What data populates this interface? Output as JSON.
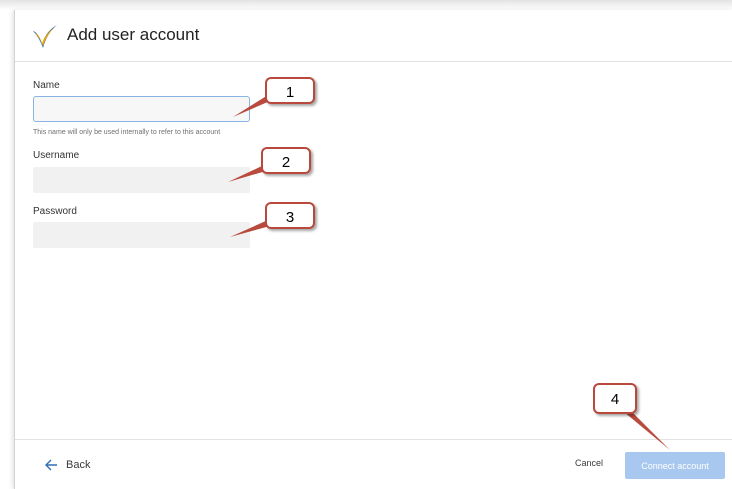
{
  "dialog": {
    "title": "Add user account",
    "logo_icon": "sap-checkmark-logo"
  },
  "form": {
    "name_label": "Name",
    "name_value": "",
    "name_hint": "This name will only be used internally to refer to this account",
    "username_label": "Username",
    "username_value": "",
    "password_label": "Password",
    "password_value": ""
  },
  "footer": {
    "back_label": "Back",
    "back_icon": "arrow-left-icon",
    "cancel_label": "Cancel",
    "connect_label": "Connect account"
  },
  "annotations": {
    "callout_1": "1",
    "callout_2": "2",
    "callout_3": "3",
    "callout_4": "4",
    "callout_color": "#b94a3e"
  },
  "colors": {
    "accent_disabled": "#a8c8ef",
    "focus_border": "#8ab3e6",
    "logo_blue": "#2f6fb5",
    "logo_gold": "#f0a800"
  }
}
